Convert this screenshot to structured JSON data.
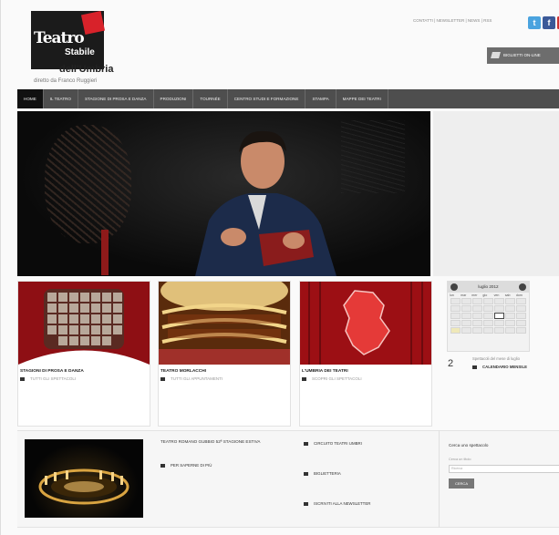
{
  "header": {
    "logo_line1": "Teatro",
    "logo_line2": "Stabile",
    "logo_line3": "dell'Umbria",
    "subtitle": "diretto da Franco Ruggieri",
    "top_links": "CONTATTI  |  NEWSLETTER  |  NEWS  |  RSS",
    "tickets_button": "BIGLIETTI ON-LINE"
  },
  "nav": {
    "items": [
      "HOME",
      "IL TEATRO",
      "STAGIONE DI PROSA E DANZA",
      "PRODUZIONI",
      "TOURNÉE",
      "CENTRO STUDI E FORMAZIONE",
      "STAMPA",
      "MAPPE DEI TEATRI"
    ]
  },
  "boxes": [
    {
      "title": "STAGIONI DI PROSA E DANZA",
      "link": "TUTTI GLI SPETTACOLI"
    },
    {
      "title": "TEATRO MORLACCHI",
      "link": "TUTTI GLI APPUNTAMENTI"
    },
    {
      "title": "L'UMBRIA DEI TEATRI",
      "link": "SCOPRI GLI SPETTACOLI"
    }
  ],
  "calendar": {
    "month": "luglio 2012",
    "days": [
      "lun",
      "mar",
      "mer",
      "gio",
      "ven",
      "sab",
      "dom"
    ],
    "event_number": "2",
    "event_label": "Spettacoli del mese di luglio",
    "event_link": "CALENDARIO MENSILE"
  },
  "bottom": {
    "text": "TEATRO ROMANO GUBBIO 52ª STAGIONE ESTIVA",
    "link_buy": "PER SAPERNE DI PIÙ",
    "link_1": "CIRCUITO TEATRI UMBRI",
    "link_2": "BIGLIETTERIA",
    "link_3": "ISCRIVITI ALLA NEWSLETTER"
  },
  "newsletter": {
    "title": "Cerca uno spettacolo",
    "label": "Cerca un titolo",
    "input_placeholder": "Ricerca",
    "button": "CERCA"
  },
  "colors": {
    "accent": "#d8222a",
    "nav_bg": "#4e4e4e",
    "logo_bg": "#1b1b1b"
  }
}
